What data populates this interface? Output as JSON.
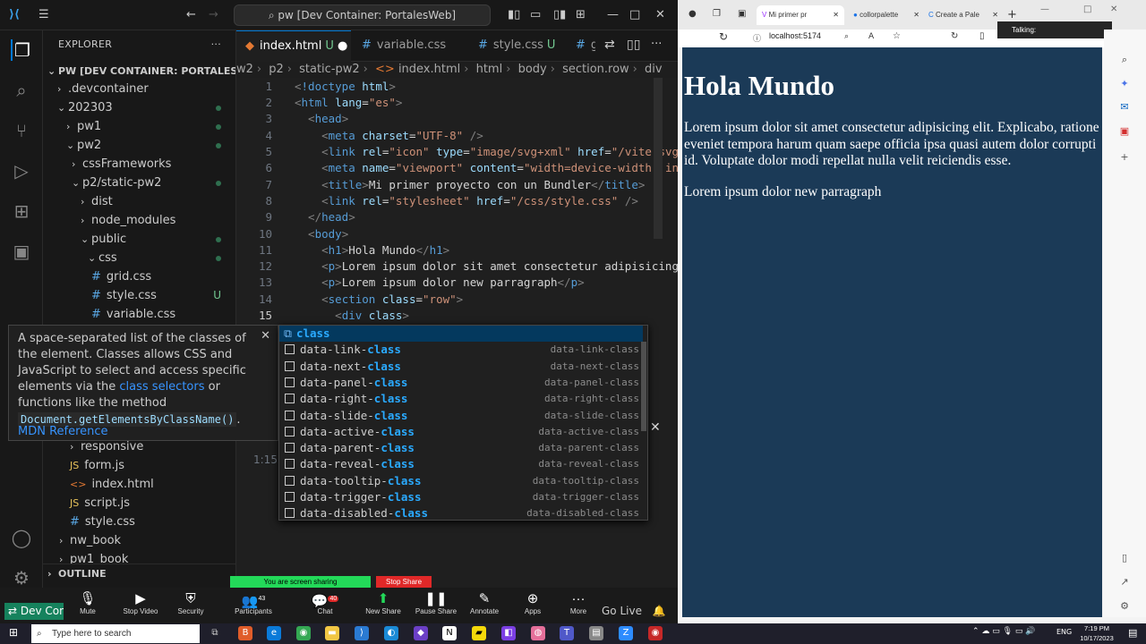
{
  "window": {
    "title": "pw [Dev Container: PortalesWeb]"
  },
  "explorer": {
    "header": "EXPLORER",
    "root": "PW [DEV CONTAINER: PORTALESWEB]",
    "items": [
      {
        "label": ".devcontainer"
      },
      {
        "label": "202303"
      },
      {
        "label": "pw1"
      },
      {
        "label": "pw2"
      },
      {
        "label": "cssFrameworks"
      },
      {
        "label": "p2/static-pw2"
      },
      {
        "label": "dist"
      },
      {
        "label": "node_modules"
      },
      {
        "label": "public"
      },
      {
        "label": "css"
      },
      {
        "label": "grid.css"
      },
      {
        "label": "style.css",
        "status": "U"
      },
      {
        "label": "variable.css"
      },
      {
        "label": "responsive"
      },
      {
        "label": "form.js"
      },
      {
        "label": "index.html"
      },
      {
        "label": "script.js"
      },
      {
        "label": "style.css"
      },
      {
        "label": "nw_book"
      },
      {
        "label": "pw1_book"
      }
    ],
    "outline": "OUTLINE"
  },
  "tabs": [
    {
      "label": "index.html",
      "status": "U"
    },
    {
      "label": "variable.css"
    },
    {
      "label": "style.css",
      "status": "U"
    },
    {
      "label": "g"
    }
  ],
  "breadcrumb": [
    "w2",
    "p2",
    "static-pw2",
    "index.html",
    "html",
    "body",
    "section.row",
    "div"
  ],
  "editor": {
    "line_numbers": [
      "1",
      "2",
      "3",
      "4",
      "5",
      "6",
      "7",
      "8",
      "9",
      "10",
      "11",
      "12",
      "13",
      "14",
      "15"
    ],
    "cursor_position": "1:15"
  },
  "suggest": {
    "items": [
      {
        "label": "class",
        "prefix": "",
        "detail": ""
      },
      {
        "label": "data-link-class",
        "prefix": "data-link-",
        "detail": "data-link-class"
      },
      {
        "label": "data-next-class",
        "prefix": "data-next-",
        "detail": "data-next-class"
      },
      {
        "label": "data-panel-class",
        "prefix": "data-panel-",
        "detail": "data-panel-class"
      },
      {
        "label": "data-right-class",
        "prefix": "data-right-",
        "detail": "data-right-class"
      },
      {
        "label": "data-slide-class",
        "prefix": "data-slide-",
        "detail": "data-slide-class"
      },
      {
        "label": "data-active-class",
        "prefix": "data-active-",
        "detail": "data-active-class"
      },
      {
        "label": "data-parent-class",
        "prefix": "data-parent-",
        "detail": "data-parent-class"
      },
      {
        "label": "data-reveal-class",
        "prefix": "data-reveal-",
        "detail": "data-reveal-class"
      },
      {
        "label": "data-tooltip-class",
        "prefix": "data-tooltip-",
        "detail": "data-tooltip-class"
      },
      {
        "label": "data-trigger-class",
        "prefix": "data-trigger-",
        "detail": "data-trigger-class"
      },
      {
        "label": "data-disabled-class",
        "prefix": "data-disabled-",
        "detail": "data-disabled-class"
      }
    ]
  },
  "docs": {
    "text1": "A space-separated list of the classes of the element. Classes allows CSS and JavaScript to select and access specific elements via the ",
    "link": "class selectors",
    "text2": " or functions like the method ",
    "code": "Document.getElementsByClassName()",
    "text3": ".",
    "mdn": "MDN Reference"
  },
  "statusbar": {
    "remote": "Dev Con",
    "golive": "Go Live"
  },
  "zoom": {
    "sharing": "You are screen sharing",
    "stop": "Stop Share",
    "items": [
      {
        "label": "Mute",
        "icon": "mic-icon"
      },
      {
        "label": "Stop Video",
        "icon": "video-icon"
      },
      {
        "label": "Security",
        "icon": "shield-icon"
      },
      {
        "label": "Participants",
        "icon": "people-icon",
        "count": "43"
      },
      {
        "label": "Chat",
        "icon": "chat-icon",
        "count": "40"
      },
      {
        "label": "New Share",
        "icon": "share-icon"
      },
      {
        "label": "Pause Share",
        "icon": "pause-icon"
      },
      {
        "label": "Annotate",
        "icon": "pen-icon"
      },
      {
        "label": "Apps",
        "icon": "apps-icon"
      },
      {
        "label": "More",
        "icon": "more-icon"
      }
    ]
  },
  "browser": {
    "tabs": [
      {
        "label": "Mi primer pr"
      },
      {
        "label": "collorpalette"
      },
      {
        "label": "Create a Pale"
      }
    ],
    "url": "localhost:5174",
    "talking": "Talking:",
    "page": {
      "heading": "Hola Mundo",
      "p1": "Lorem ipsum dolor sit amet consectetur adipisicing elit. Explicabo, ratione eveniet tempora harum quam saepe officia ipsa quasi autem dolor corrupti id. Voluptate dolor modi repellat nulla velit reiciendis esse.",
      "p2": "Lorem ipsum dolor new parragraph"
    }
  },
  "taskbar": {
    "search": "Type here to search",
    "lang": "ENG",
    "time": "7:19 PM",
    "date": "10/17/2023"
  },
  "colors": {
    "page_bg": "#1b3a57",
    "accent": "#0078d4",
    "remote_badge": "#16825d"
  }
}
